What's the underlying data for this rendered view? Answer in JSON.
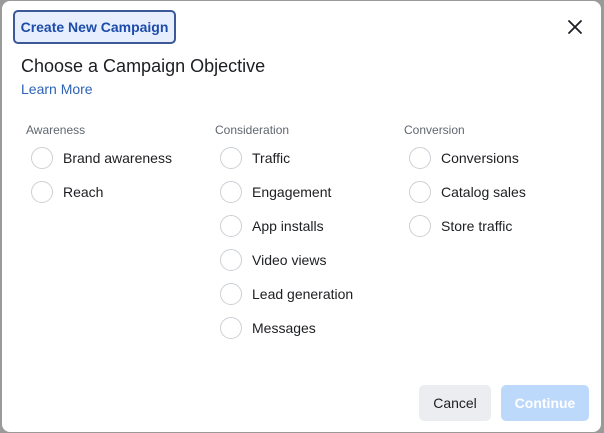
{
  "dialog": {
    "title_button": "Create New Campaign",
    "heading": "Choose a Campaign Objective",
    "learn_more": "Learn More",
    "close_icon": "close-icon"
  },
  "columns": [
    {
      "header": "Awareness",
      "options": [
        "Brand awareness",
        "Reach"
      ]
    },
    {
      "header": "Consideration",
      "options": [
        "Traffic",
        "Engagement",
        "App installs",
        "Video views",
        "Lead generation",
        "Messages"
      ]
    },
    {
      "header": "Conversion",
      "options": [
        "Conversions",
        "Catalog sales",
        "Store traffic"
      ]
    }
  ],
  "footer": {
    "cancel_label": "Cancel",
    "continue_label": "Continue",
    "continue_disabled": true
  },
  "colors": {
    "accent": "#1c4ba8",
    "link": "#2d63b6",
    "continue_disabled_bg": "#bcd8fb"
  }
}
